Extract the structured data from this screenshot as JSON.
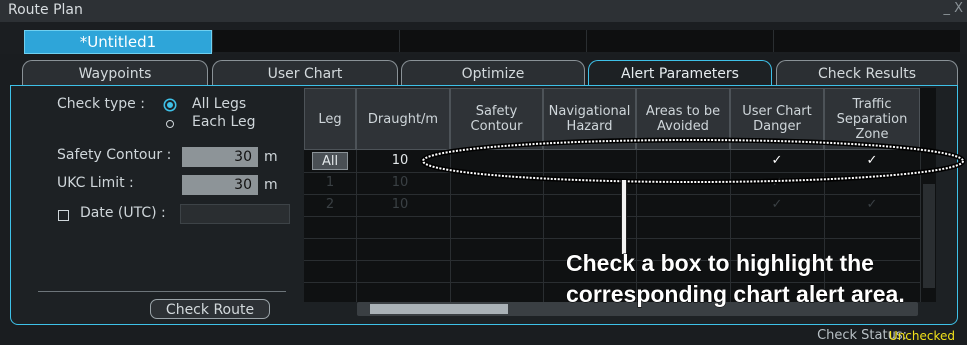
{
  "window": {
    "title": "Route Plan",
    "controls": "_ X"
  },
  "route": {
    "name": "*Untitled1"
  },
  "tabs": [
    {
      "label": "Waypoints"
    },
    {
      "label": "User Chart"
    },
    {
      "label": "Optimize"
    },
    {
      "label": "Alert Parameters",
      "active": true
    },
    {
      "label": "Check Results"
    }
  ],
  "params": {
    "check_type_label": "Check type :",
    "check_type_options": [
      {
        "label": "All Legs",
        "selected": true
      },
      {
        "label": "Each Leg",
        "selected": false
      }
    ],
    "safety_contour_label": "Safety Contour :",
    "safety_contour_value": "30",
    "safety_contour_unit": "m",
    "ukc_limit_label": "UKC Limit :",
    "ukc_limit_value": "30",
    "ukc_limit_unit": "m",
    "date_label": "Date (UTC) :",
    "date_value": "",
    "check_route_label": "Check Route"
  },
  "grid": {
    "headers": [
      "Leg",
      "Draught/m",
      "Safety Contour",
      "Navigational Hazard",
      "Areas to be Avoided",
      "User Chart Danger",
      "Traffic Separation Zone"
    ],
    "rows": [
      {
        "leg": "All",
        "draught": "10",
        "checks": [
          false,
          false,
          false,
          true,
          true
        ]
      },
      {
        "leg": "1",
        "draught": "10",
        "checks": [
          false,
          false,
          false,
          true,
          false
        ]
      },
      {
        "leg": "2",
        "draught": "10",
        "checks": [
          false,
          false,
          false,
          true,
          true
        ]
      }
    ],
    "check_mark": "✓"
  },
  "callout": {
    "line1": "Check a box to highlight the",
    "line2": "corresponding chart alert area."
  },
  "status": {
    "label": "Check Status:",
    "value": "Unchecked"
  },
  "colors": {
    "accent": "#3ec1e8",
    "status_value": "#f2e21a",
    "name_field": "#2ea5d9"
  }
}
